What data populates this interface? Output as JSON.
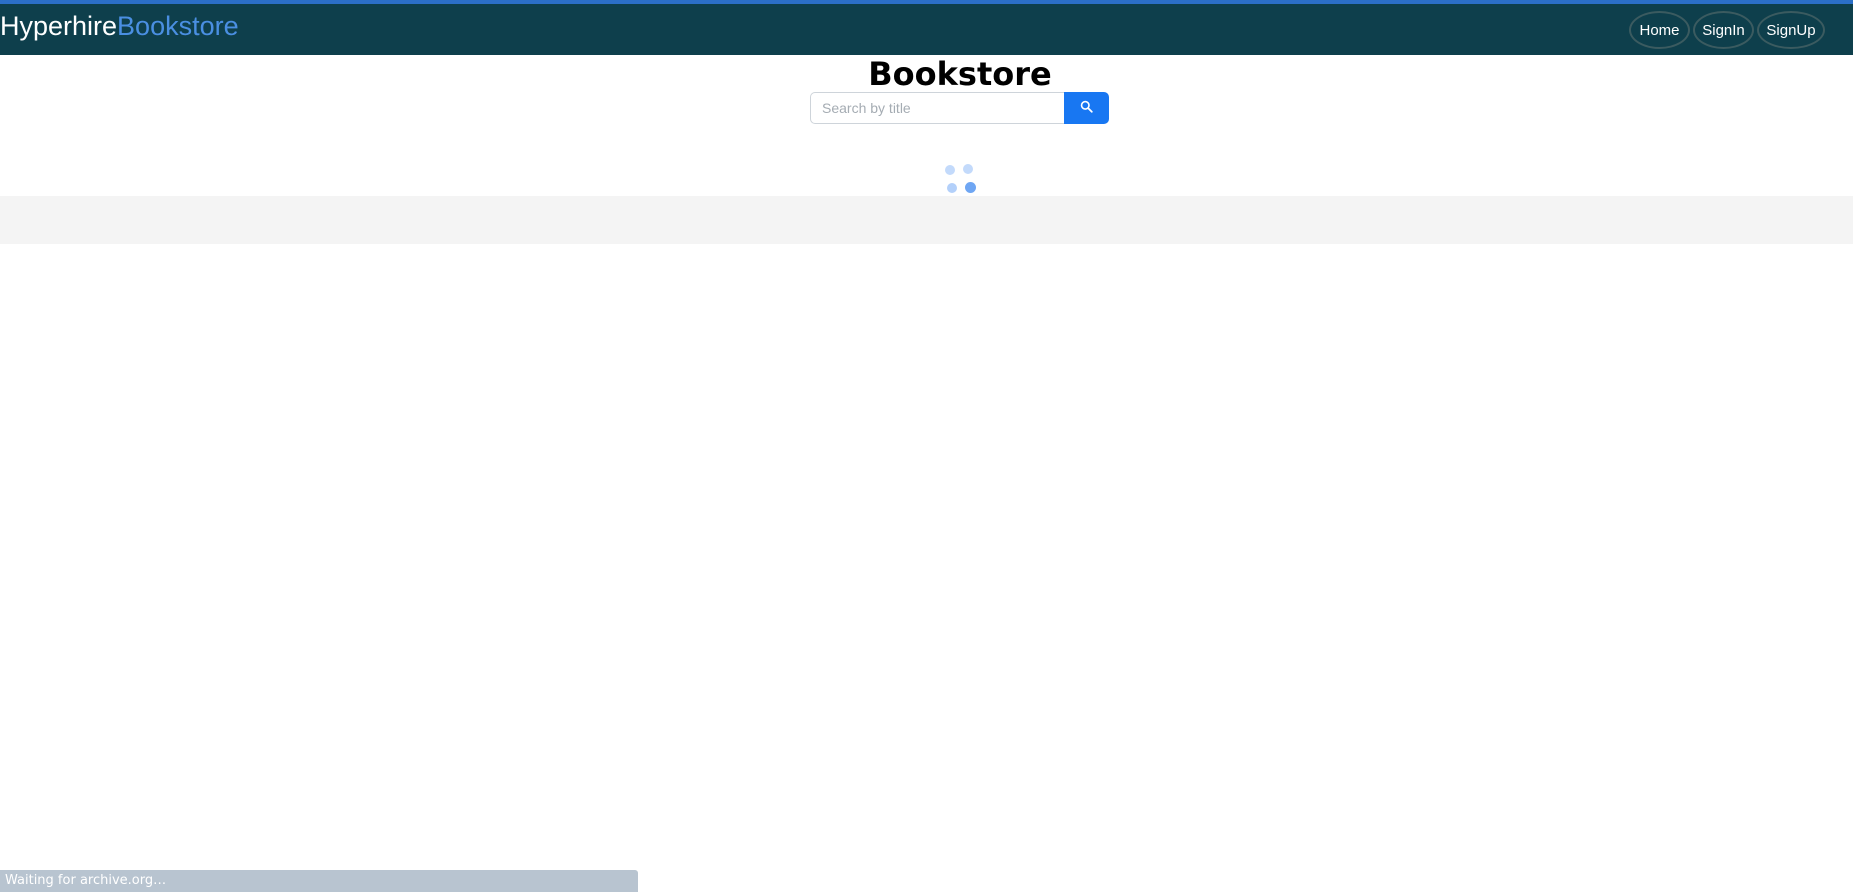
{
  "brand": {
    "part1": "Hyperhire",
    "part2": "Bookstore"
  },
  "nav": {
    "home_label": "Home",
    "signin_label": "SignIn",
    "signup_label": "SignUp"
  },
  "main": {
    "title": "Bookstore",
    "search": {
      "placeholder": "Search by title",
      "value": "",
      "button_icon": "search-icon"
    },
    "loading_indicator": "loading-spinner-icon"
  },
  "status_bar": {
    "text": "Waiting for archive.org…"
  },
  "colors": {
    "navbar_bg": "#0e3f4c",
    "accent": "#1877f2",
    "brand_secondary": "#4a8fe2"
  }
}
